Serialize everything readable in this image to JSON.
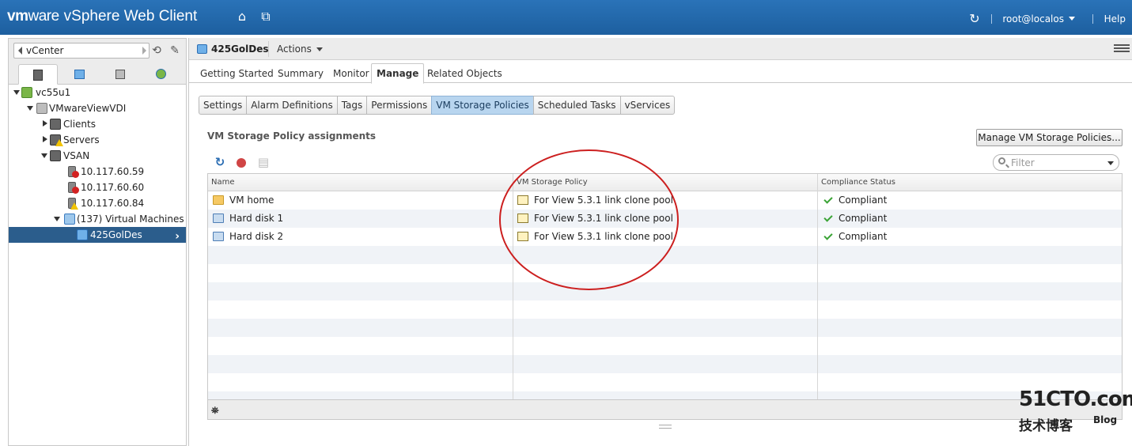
{
  "app": {
    "brand_vm": "vm",
    "brand_ware": "ware",
    "product": "vSphere Web Client",
    "user": "root@localos",
    "help": "Help"
  },
  "navigator": {
    "breadcrumb": "vCenter",
    "tree": [
      {
        "label": "vc55u1",
        "icon": "vcenter-icon"
      },
      {
        "label": "VMwareViewVDI",
        "icon": "datacenter-icon"
      },
      {
        "label": "Clients",
        "icon": "cluster-icon"
      },
      {
        "label": "Servers",
        "icon": "cluster-icon"
      },
      {
        "label": "VSAN",
        "icon": "cluster-icon"
      },
      {
        "label": "10.117.60.59",
        "icon": "host-icon"
      },
      {
        "label": "10.117.60.60",
        "icon": "host-icon"
      },
      {
        "label": "10.117.60.84",
        "icon": "host-icon"
      },
      {
        "label": "(137) Virtual Machines",
        "icon": "vm-folder-icon"
      },
      {
        "label": "425GolDes",
        "icon": "vm-icon"
      }
    ]
  },
  "object": {
    "title": "425GolDes",
    "actions": "Actions"
  },
  "tabs": [
    "Getting Started",
    "Summary",
    "Monitor",
    "Manage",
    "Related Objects"
  ],
  "subtabs": [
    "Settings",
    "Alarm Definitions",
    "Tags",
    "Permissions",
    "VM Storage Policies",
    "Scheduled Tasks",
    "vServices"
  ],
  "section": {
    "title": "VM Storage Policy assignments",
    "manage_button": "Manage VM Storage Policies...",
    "filter_placeholder": "Filter"
  },
  "grid": {
    "columns": [
      "Name",
      "VM Storage Policy",
      "Compliance Status"
    ],
    "rows": [
      {
        "name": "VM home",
        "policy": "For View 5.3.1 link clone pool",
        "status": "Compliant"
      },
      {
        "name": "Hard disk 1",
        "policy": "For View 5.3.1 link clone pool",
        "status": "Compliant"
      },
      {
        "name": "Hard disk 2",
        "policy": "For View 5.3.1 link clone pool",
        "status": "Compliant"
      }
    ]
  },
  "watermark": {
    "site": "51CTO.com",
    "tagline": "技术博客",
    "blog": "Blog"
  },
  "colors": {
    "topbar": "#1d5f9f",
    "selection": "#2b5d8c",
    "active_subtab": "#b8d5ef",
    "annotation": "#cc1f1f",
    "compliant": "#3aa335"
  }
}
